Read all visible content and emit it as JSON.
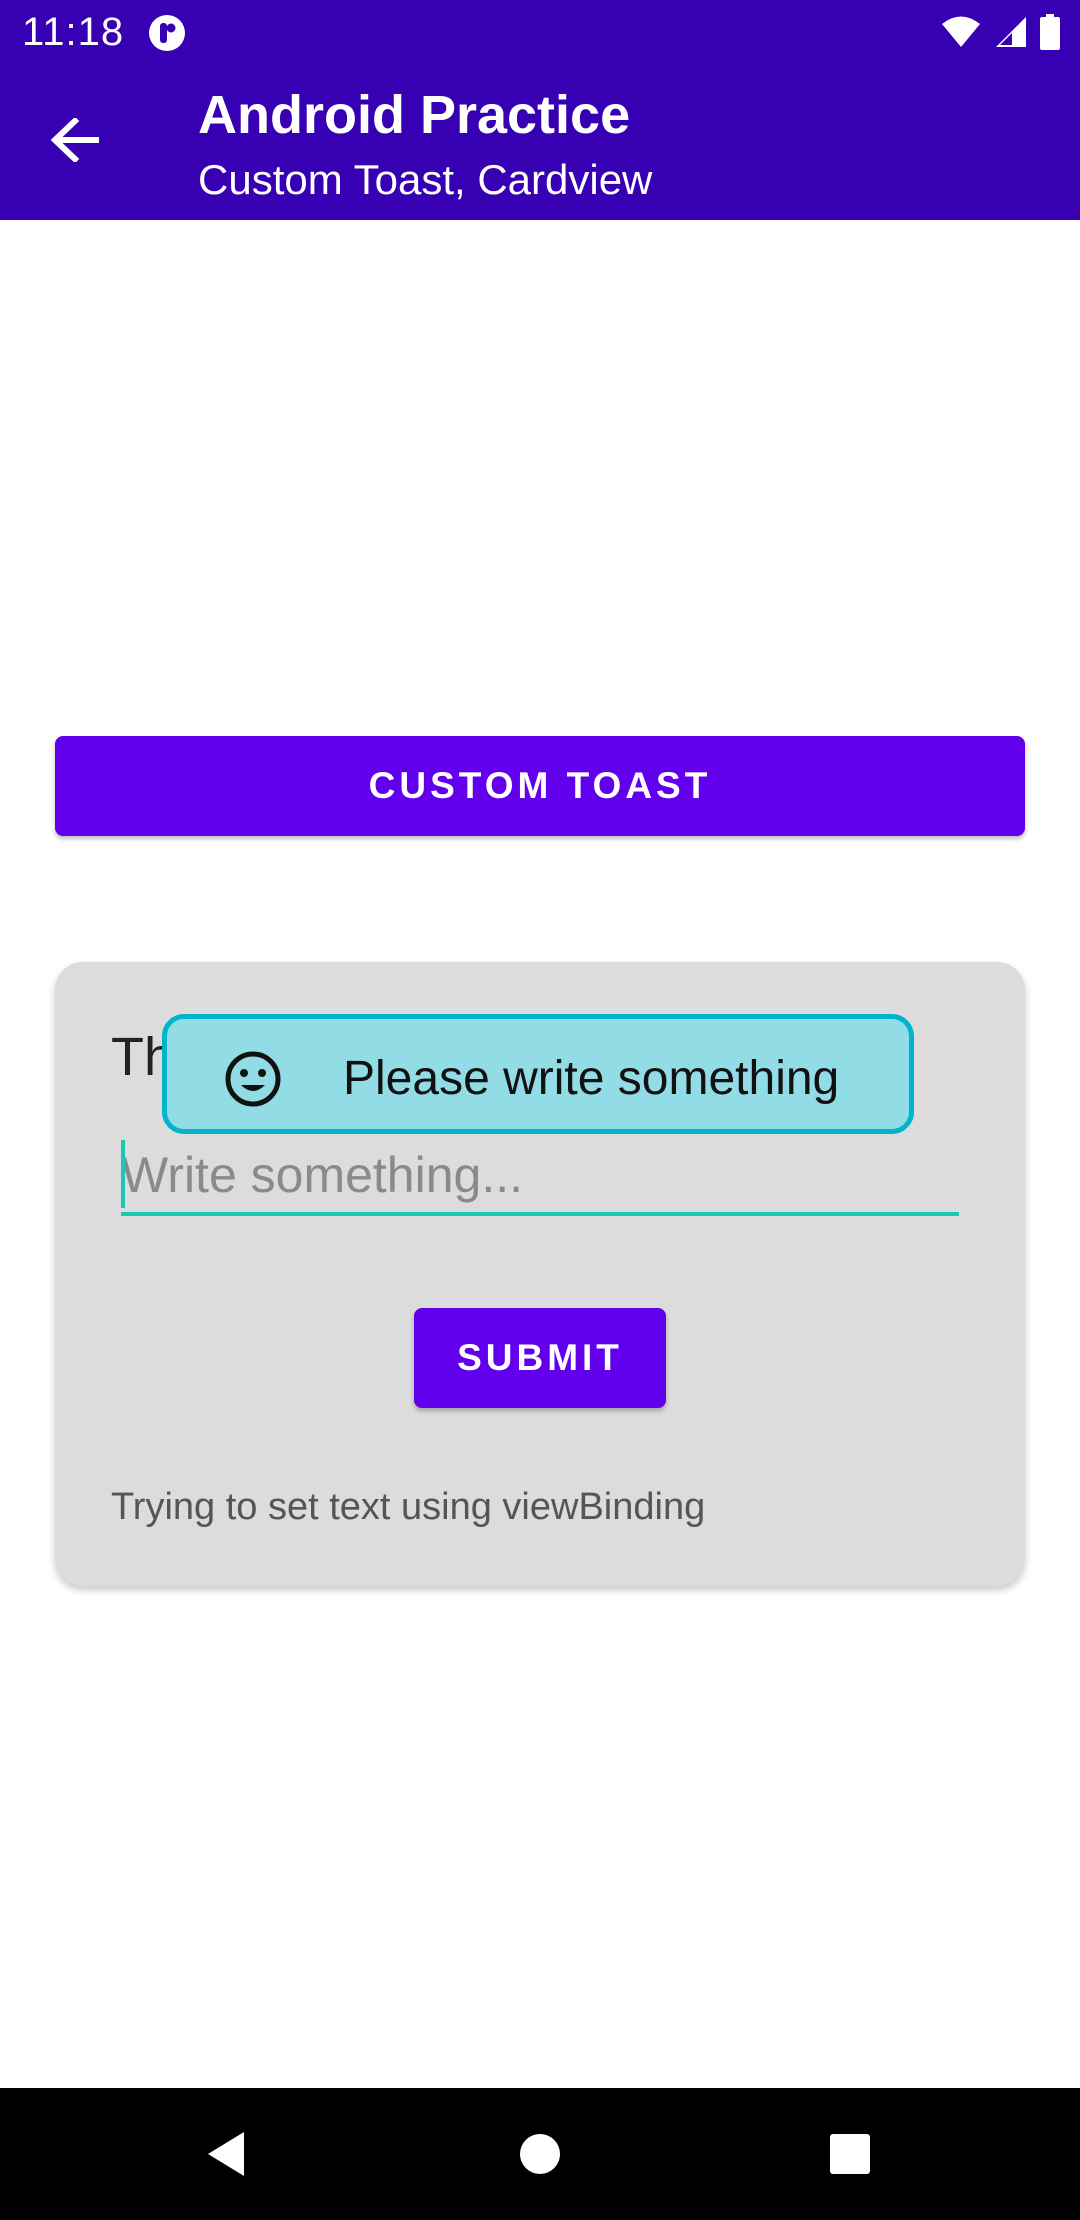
{
  "status_bar": {
    "time": "11:18",
    "icons": [
      "app-notification-icon",
      "wifi-icon",
      "signal-icon",
      "battery-icon"
    ]
  },
  "app_bar": {
    "title": "Android Practice",
    "subtitle": "Custom Toast, Cardview",
    "back_icon": "arrow-left-icon",
    "background_color": "#3700B3"
  },
  "main": {
    "custom_toast_button_label": "CUSTOM TOAST",
    "accent_color": "#6200EE"
  },
  "card": {
    "title_visible_prefix": "Th",
    "input": {
      "value": "",
      "placeholder": "Write something...",
      "underline_color": "#18C8B0"
    },
    "submit_label": "SUBMIT",
    "footnote": "Trying to set text using viewBinding",
    "background_color": "#DCDCDC"
  },
  "toast": {
    "icon": "smiley-face-icon",
    "message": "Please write something",
    "background_color": "#92DCE5",
    "border_color": "#00B4CC"
  },
  "nav_bar": {
    "buttons": [
      "back-triangle-icon",
      "home-circle-icon",
      "recents-square-icon"
    ]
  }
}
